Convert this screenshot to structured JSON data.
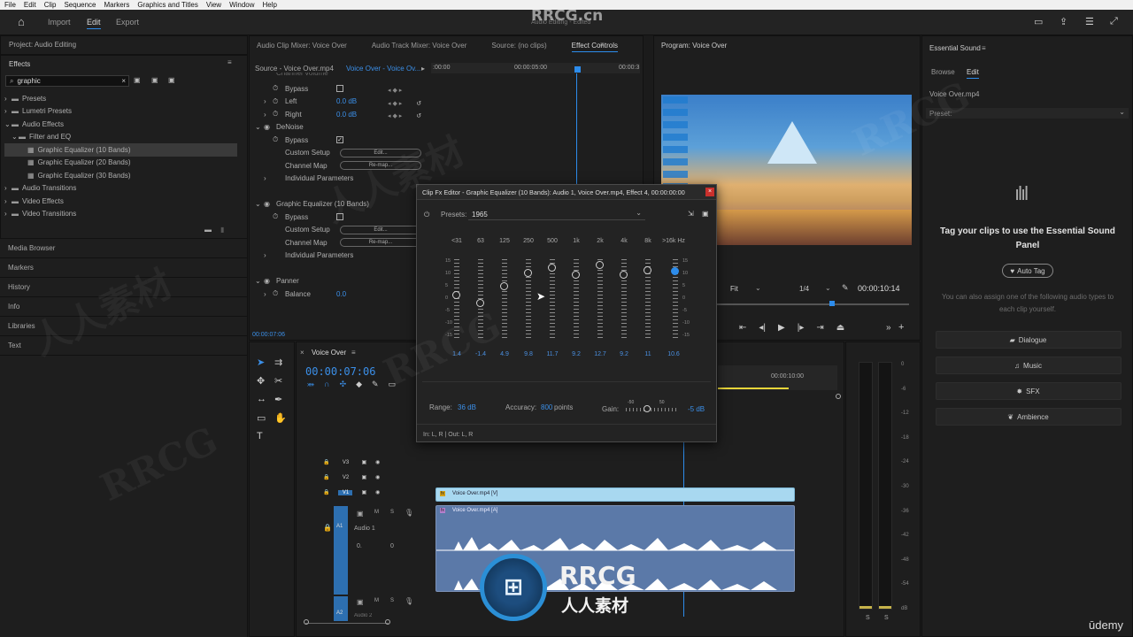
{
  "menu": [
    "File",
    "Edit",
    "Clip",
    "Sequence",
    "Markers",
    "Graphics and Titles",
    "View",
    "Window",
    "Help"
  ],
  "workspace": {
    "tabs": [
      "Import",
      "Edit",
      "Export"
    ],
    "active": "Edit",
    "title": "Audio Editing - Edited"
  },
  "project": {
    "title": "Project: Audio Editing"
  },
  "effects": {
    "title": "Effects",
    "search": "graphic",
    "tree": [
      {
        "label": "Presets",
        "level": 0
      },
      {
        "label": "Lumetri Presets",
        "level": 0
      },
      {
        "label": "Audio Effects",
        "level": 0,
        "open": true
      },
      {
        "label": "Filter and EQ",
        "level": 1,
        "open": true
      },
      {
        "label": "Graphic Equalizer (10 Bands)",
        "level": 2,
        "selected": true
      },
      {
        "label": "Graphic Equalizer (20 Bands)",
        "level": 2
      },
      {
        "label": "Graphic Equalizer (30 Bands)",
        "level": 2
      },
      {
        "label": "Audio Transitions",
        "level": 0
      },
      {
        "label": "Video Effects",
        "level": 0
      },
      {
        "label": "Video Transitions",
        "level": 0
      }
    ]
  },
  "left_panels": [
    "Media Browser",
    "Markers",
    "History",
    "Info",
    "Libraries",
    "Text"
  ],
  "source_tabs": [
    "Audio Clip Mixer: Voice Over",
    "Audio Track Mixer: Voice Over",
    "Source: (no clips)",
    "Effect Controls"
  ],
  "effect_controls": {
    "source": "Source - Voice Over.mp4",
    "clip": "Voice Over - Voice Ov...",
    "time_start": ":00:00",
    "time_mid": "00:00:05:00",
    "time_end": "00:00:3",
    "cut_label": "Channel Volume",
    "rows": [
      {
        "label": "Bypass",
        "type": "check",
        "checked": false
      },
      {
        "label": "Left",
        "value": "0.0 dB"
      },
      {
        "label": "Right",
        "value": "0.0 dB"
      },
      {
        "label": "DeNoise",
        "type": "header"
      },
      {
        "label": "Bypass",
        "type": "check",
        "checked": true
      },
      {
        "label": "Custom Setup",
        "button": "Edit..."
      },
      {
        "label": "Channel Map",
        "button": "Re-map..."
      },
      {
        "label": "Individual Parameters",
        "type": "sub"
      },
      {
        "label": "Graphic Equalizer (10 Bands)",
        "type": "header"
      },
      {
        "label": "Bypass",
        "type": "check",
        "checked": false
      },
      {
        "label": "Custom Setup",
        "button": "Edit..."
      },
      {
        "label": "Channel Map",
        "button": "Re-map..."
      },
      {
        "label": "Individual Parameters",
        "type": "sub"
      },
      {
        "label": "Panner",
        "type": "header"
      },
      {
        "label": "Balance",
        "value": "0.0"
      }
    ],
    "timecode": "00:00:07:06"
  },
  "program": {
    "title": "Program: Voice Over",
    "fit": "Fit",
    "ratio": "1/4",
    "timecode": "00:00:10:14"
  },
  "fx_editor": {
    "title": "Clip Fx Editor - Graphic Equalizer (10 Bands): Audio 1, Voice Over.mp4, Effect 4, 00:00:00:00",
    "presets_label": "Presets:",
    "preset": "1965",
    "bands": [
      "<31",
      "63",
      "125",
      "250",
      "500",
      "1k",
      "2k",
      "4k",
      "8k",
      ">16k Hz"
    ],
    "values": [
      "1.4",
      "-1.4",
      "4.9",
      "9.8",
      "11.7",
      "9.2",
      "12.7",
      "9.2",
      "11",
      "10.6"
    ],
    "levels": [
      1.4,
      -1.4,
      4.9,
      9.8,
      11.7,
      9.2,
      12.7,
      9.2,
      11,
      10.6
    ],
    "scale": [
      "15",
      "10",
      "5",
      "0",
      "-5",
      "-10",
      "-15"
    ],
    "range_label": "Range:",
    "range": "36 dB",
    "accuracy_label": "Accuracy:",
    "accuracy": "800",
    "accuracy_unit": "points",
    "gain_label": "Gain:",
    "gain_min": "-50",
    "gain_max": "50",
    "gain": "-5 dB",
    "io": "In: L, R | Out: L, R"
  },
  "timeline": {
    "sequence": "Voice Over",
    "timecode": "00:00:07:06",
    "ruler": "00:00:10:00",
    "tracks": [
      {
        "name": "V3",
        "type": "video"
      },
      {
        "name": "V2",
        "type": "video"
      },
      {
        "name": "V1",
        "type": "video"
      },
      {
        "name": "A1",
        "type": "audio",
        "label": "Audio 1",
        "vol": "0.",
        "pan": "0"
      },
      {
        "name": "A2",
        "type": "audio",
        "label": "Audio 2"
      }
    ],
    "video_clip": "Voice Over.mp4 [V]",
    "audio_clip": "Voice Over.mp4 [A]"
  },
  "meter": {
    "scale": [
      "0",
      "-6",
      "-12",
      "-18",
      "-24",
      "-30",
      "-36",
      "-42",
      "-48",
      "-54",
      "dB"
    ],
    "solo": [
      "S",
      "S"
    ]
  },
  "essential_sound": {
    "title": "Essential Sound",
    "tabs": [
      "Browse",
      "Edit"
    ],
    "active": "Edit",
    "clip": "Voice Over.mp4",
    "preset_label": "Preset:",
    "heading": "Tag your clips to use the Essential Sound Panel",
    "autotag": "Auto Tag",
    "hint": "You can also assign one of the following audio types to each clip yourself.",
    "types": [
      {
        "label": "Dialogue",
        "icon": "dialogue-icon"
      },
      {
        "label": "Music",
        "icon": "music-icon"
      },
      {
        "label": "SFX",
        "icon": "sfx-icon"
      },
      {
        "label": "Ambience",
        "icon": "ambience-icon"
      }
    ]
  },
  "branding": {
    "watermark": "RRCG.cn",
    "logo": "RRCG",
    "logo_sub": "人人素材",
    "udemy": "ūdemy"
  },
  "colors": {
    "accent": "#2d8ceb",
    "video_clip": "#a8d8f0",
    "audio_clip": "#5b79a8"
  }
}
